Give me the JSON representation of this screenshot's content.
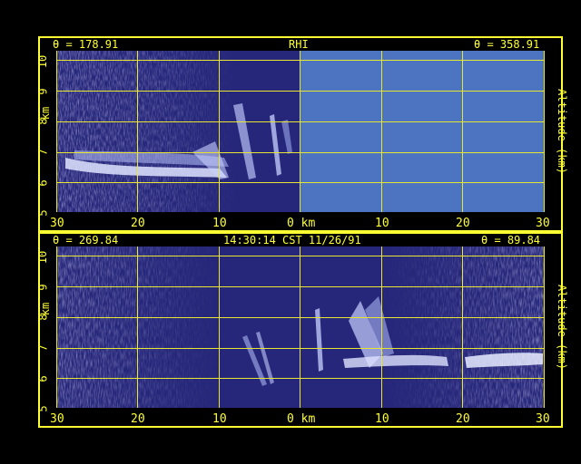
{
  "top": {
    "theta_left": "θ = 178.91",
    "title": "RHI",
    "theta_right": "θ = 358.91",
    "y_label_left": "km",
    "y_label_right": "Altitude (km)",
    "x_ticks": [
      "30",
      "20",
      "10",
      "0 km",
      "10",
      "20",
      "30"
    ],
    "y_ticks": [
      "5",
      "6",
      "7",
      "8",
      "9",
      "10"
    ]
  },
  "bottom": {
    "theta_left": "θ = 269.84",
    "timestamp": "14:30:14 CST 11/26/91",
    "theta_right": "θ = 89.84",
    "y_label_left": "km",
    "y_label_right": "Altitude (km)",
    "x_ticks": [
      "30",
      "20",
      "10",
      "0 km",
      "10",
      "20",
      "30"
    ],
    "y_ticks": [
      "5",
      "6",
      "7",
      "8",
      "9",
      "10"
    ]
  },
  "colors": {
    "frame": "#ffff33",
    "plot_bg": "#26267a",
    "no_data": "#4d74c0",
    "echo": "#e8ecff"
  }
}
